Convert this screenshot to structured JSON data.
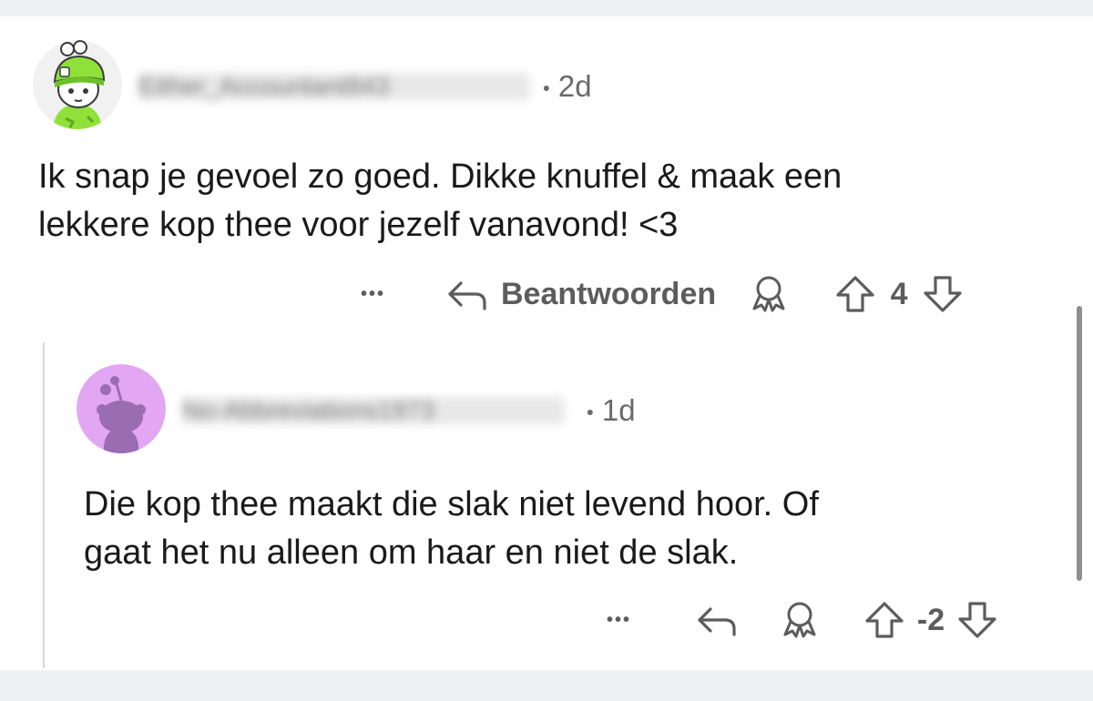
{
  "comments": [
    {
      "username": "Either_Accountant843",
      "time": "2d",
      "text_line1": "Ik snap je gevoel zo goed. Dikke knuffel & maak een",
      "text_line2": "lekkere kop thee voor jezelf vanavond! <3",
      "more": "•••",
      "reply_label": "Beantwoorden",
      "score": "4",
      "avatar_icon": "snoo-green-beanie-avatar"
    },
    {
      "username": "No-Abbreviations1973",
      "time": "1d",
      "text_line1": "Die kop thee maakt die slak niet levend hoor. Of",
      "text_line2": "gaat het nu alleen om haar en niet de slak.",
      "more": "•••",
      "score": "-2",
      "avatar_icon": "snoo-default-purple-avatar"
    }
  ],
  "separator": "•",
  "colors": {
    "text": "#1a1a1b",
    "meta": "#6a6a6a",
    "action": "#5c5c5c",
    "avatar_bg_purple": "#e3a6f2",
    "snoo_purple": "#9a6db3",
    "beanie_green": "#8fe13a"
  }
}
